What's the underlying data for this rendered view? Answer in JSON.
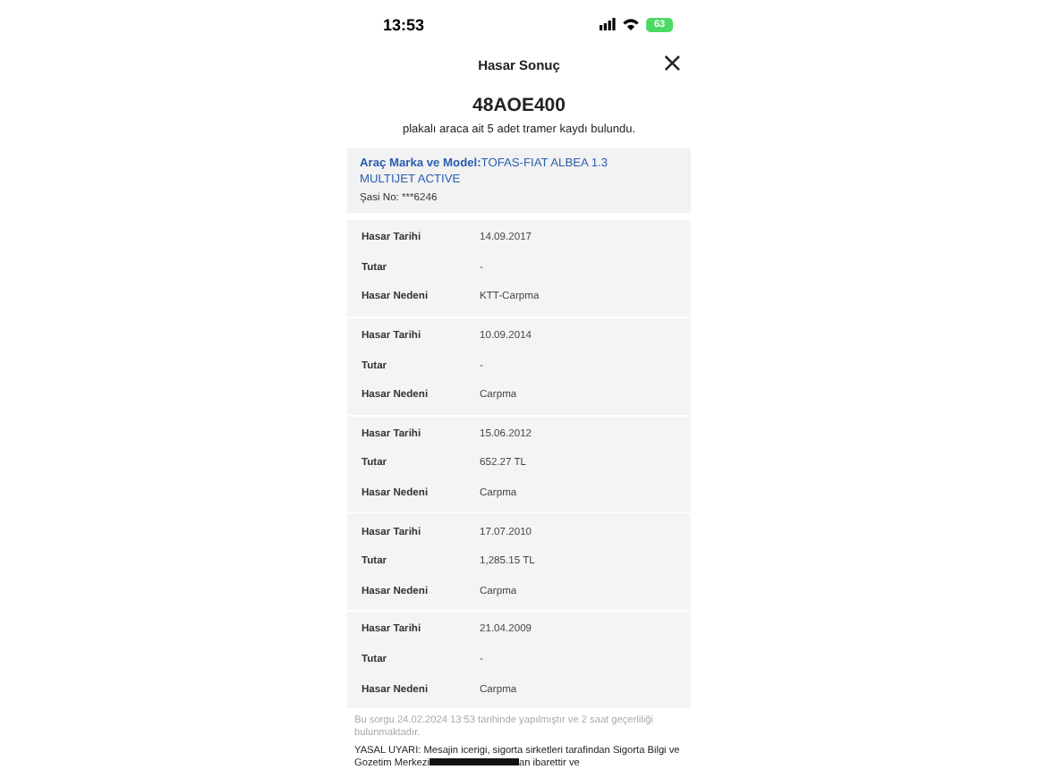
{
  "status_bar": {
    "time": "13:53",
    "battery": "63"
  },
  "header": {
    "title": "Hasar Sonuç",
    "close": "×"
  },
  "plate": "48AOE400",
  "summary": "plakalı araca ait 5 adet tramer kaydı bulundu.",
  "vehicle": {
    "label": "Araç Marka ve Model:",
    "value": "TOFAS-FIAT ALBEA 1.3 MULTIJET ACTIVE",
    "chassis": "Şasi No: ***6246"
  },
  "records": [
    {
      "fields": [
        {
          "label": "Hasar Tarihi",
          "value": "14.09.2017"
        },
        {
          "label": "Tutar",
          "value": "-"
        },
        {
          "label": "Hasar Nedeni",
          "value": "KTT-Carpma"
        }
      ]
    },
    {
      "fields": [
        {
          "label": "Hasar Tarihi",
          "value": "10.09.2014"
        },
        {
          "label": "Tutar",
          "value": "-"
        },
        {
          "label": "Hasar Nedeni",
          "value": "Carpma"
        }
      ]
    },
    {
      "fields": [
        {
          "label": "Hasar Tarihi",
          "value": "15.06.2012"
        },
        {
          "label": "Tutar",
          "value": "652.27 TL"
        },
        {
          "label": "Hasar Nedeni",
          "value": "Carpma"
        }
      ]
    },
    {
      "fields": [
        {
          "label": "Hasar Tarihi",
          "value": "17.07.2010"
        },
        {
          "label": "Tutar",
          "value": "1,285.15 TL"
        },
        {
          "label": "Hasar Nedeni",
          "value": "Carpma"
        }
      ]
    },
    {
      "fields": [
        {
          "label": "Hasar Tarihi",
          "value": "21.04.2009"
        },
        {
          "label": "Tutar",
          "value": "-"
        },
        {
          "label": "Hasar Nedeni",
          "value": "Carpma"
        }
      ]
    }
  ],
  "note": "Bu sorgu 24.02.2024 13:53 tarihinde yapılmıştır ve 2 saat geçerliliği bulunmaktadır.",
  "warning": {
    "before": "YASAL UYARI: Mesajin icerigi, sigorta sirketleri tarafindan Sigorta Bilgi ve Gozetim Merkezi",
    "after": "an ibarettir ve"
  }
}
